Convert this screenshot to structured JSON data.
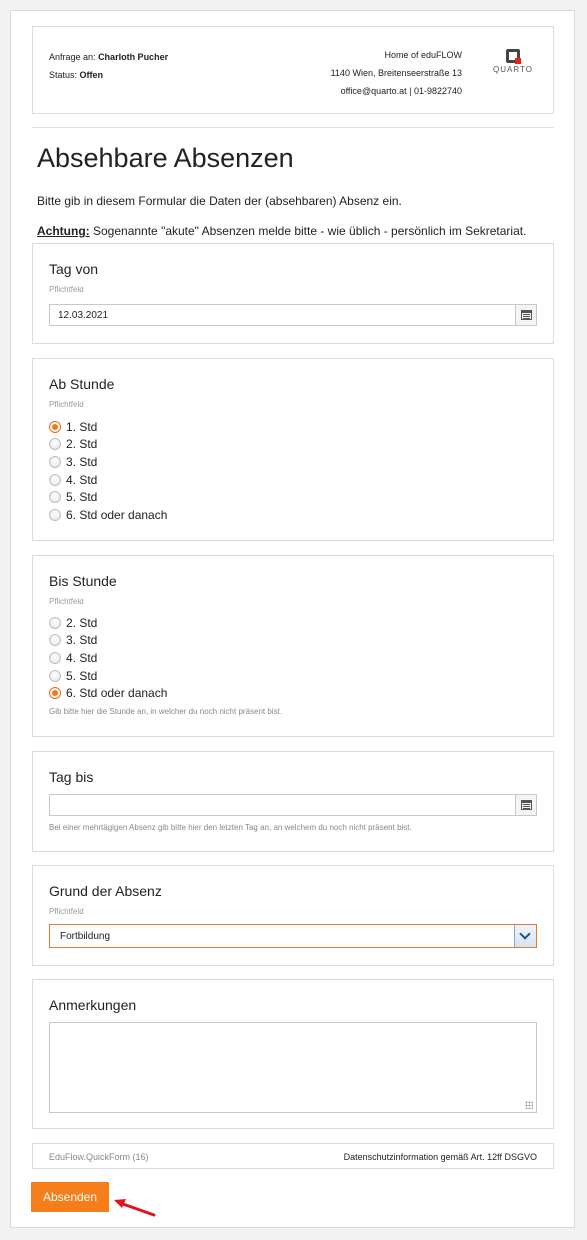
{
  "header": {
    "request_prefix": "Anfrage an:",
    "request_name": "Charloth Pucher",
    "status_prefix": "Status:",
    "status_value": "Offen",
    "home_line": "Home of eduFLOW",
    "address_line": "1140 Wien, Breitenseerstraße 13",
    "contact_line": "office@quarto.at | 01-9822740",
    "logo_text": "QUARTO"
  },
  "page": {
    "title": "Absehbare Absenzen",
    "intro": "Bitte gib in diesem Formular die Daten der (absehbaren) Absenz ein.",
    "warning_label": "Achtung:",
    "warning_text": "Sogenannte \"akute\" Absenzen melde bitte - wie üblich - persönlich im Sekretariat."
  },
  "fields": {
    "tag_von": {
      "label": "Tag von",
      "required": "Pflichtfeld",
      "value": "12.03.2021",
      "icon": "calendar-icon"
    },
    "ab_stunde": {
      "label": "Ab Stunde",
      "required": "Pflichtfeld",
      "options": [
        "1. Std",
        "2. Std",
        "3. Std",
        "4. Std",
        "5. Std",
        "6. Std oder danach"
      ],
      "selected": "1. Std"
    },
    "bis_stunde": {
      "label": "Bis Stunde",
      "required": "Pflichtfeld",
      "options": [
        "2. Std",
        "3. Std",
        "4. Std",
        "5. Std",
        "6. Std oder danach"
      ],
      "selected": "6. Std oder danach",
      "help": "Gib bitte hier die Stunde an, in welcher du noch nicht präsent bist."
    },
    "tag_bis": {
      "label": "Tag bis",
      "value": "",
      "icon": "calendar-icon",
      "help": "Bei einer mehrtägigen Absenz gib bitte hier den letzten Tag an, an welchem du noch nicht präsent bist."
    },
    "grund": {
      "label": "Grund der Absenz",
      "required": "Pflichtfeld",
      "selected": "Fortbildung",
      "icon": "chevron-down-icon"
    },
    "anmerkungen": {
      "label": "Anmerkungen",
      "value": ""
    }
  },
  "footer": {
    "left": "EduFlow.QuickForm (16)",
    "right": "Datenschutzinformation gemäß Art. 12ff DSGVO"
  },
  "actions": {
    "submit_label": "Absenden"
  },
  "colors": {
    "accent": "#f57e1a",
    "arrow": "#e0141e"
  }
}
